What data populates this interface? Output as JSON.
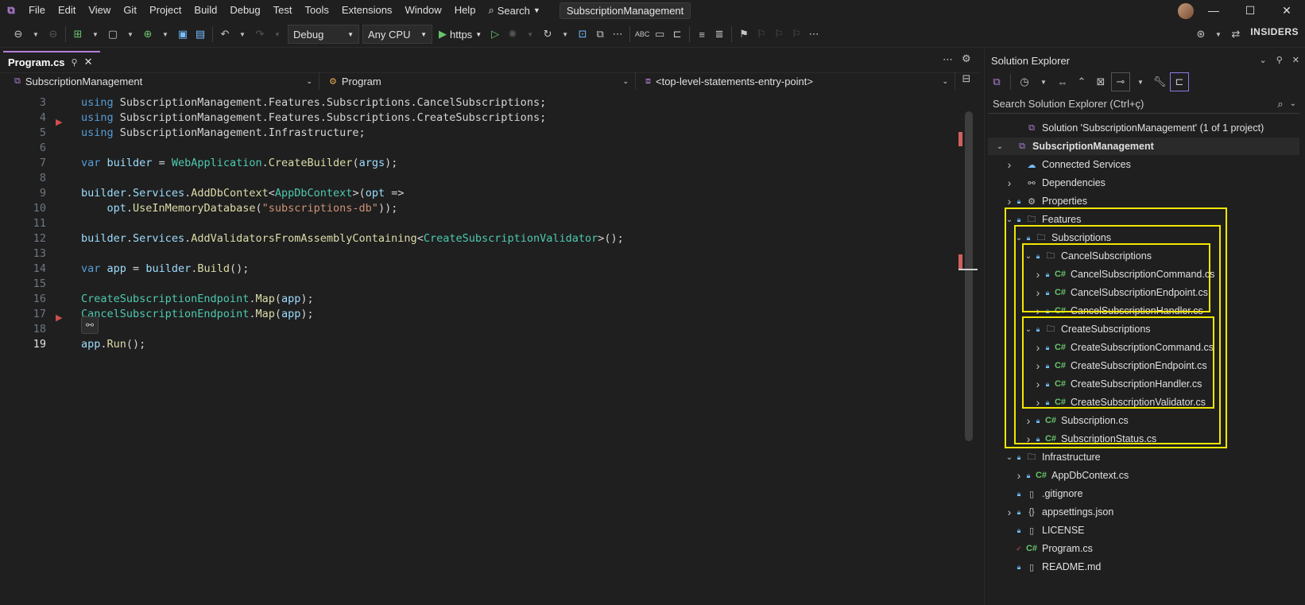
{
  "menu": [
    "File",
    "Edit",
    "View",
    "Git",
    "Project",
    "Build",
    "Debug",
    "Test",
    "Tools",
    "Extensions",
    "Window",
    "Help"
  ],
  "search_label": "Search",
  "window_title": "SubscriptionManagement",
  "toolbar": {
    "config": "Debug",
    "platform": "Any CPU",
    "run_profile": "https",
    "insiders": "INSIDERS"
  },
  "editor_tab": {
    "label": "Program.cs"
  },
  "navbar": {
    "project": "SubscriptionManagement",
    "type": "Program",
    "member": "<top-level-statements-entry-point>"
  },
  "code_lines": [
    {
      "n": "3",
      "tokens": [
        [
          "kw",
          "using"
        ],
        [
          "pl",
          " SubscriptionManagement.Features.Subscriptions.CancelSubscriptions;"
        ]
      ]
    },
    {
      "n": "4",
      "tokens": [
        [
          "kw",
          "using"
        ],
        [
          "pl",
          " SubscriptionManagement.Features.Subscriptions.CreateSubscriptions;"
        ]
      ]
    },
    {
      "n": "5",
      "tokens": [
        [
          "kw",
          "using"
        ],
        [
          "pl",
          " SubscriptionManagement.Infrastructure;"
        ]
      ]
    },
    {
      "n": "6",
      "tokens": []
    },
    {
      "n": "7",
      "tokens": [
        [
          "kw",
          "var"
        ],
        [
          "pl",
          " "
        ],
        [
          "id",
          "builder"
        ],
        [
          "pl",
          " = "
        ],
        [
          "ty",
          "WebApplication"
        ],
        [
          "pl",
          "."
        ],
        [
          "fn",
          "CreateBuilder"
        ],
        [
          "pl",
          "("
        ],
        [
          "id",
          "args"
        ],
        [
          "pl",
          ");"
        ]
      ]
    },
    {
      "n": "8",
      "tokens": []
    },
    {
      "n": "9",
      "tokens": [
        [
          "id",
          "builder"
        ],
        [
          "pl",
          "."
        ],
        [
          "id",
          "Services"
        ],
        [
          "pl",
          "."
        ],
        [
          "fn",
          "AddDbContext"
        ],
        [
          "pl",
          "<"
        ],
        [
          "ty",
          "AppDbContext"
        ],
        [
          "pl",
          ">("
        ],
        [
          "id",
          "opt"
        ],
        [
          "pl",
          " =>"
        ]
      ]
    },
    {
      "n": "10",
      "tokens": [
        [
          "pl",
          "    "
        ],
        [
          "id",
          "opt"
        ],
        [
          "pl",
          "."
        ],
        [
          "fn",
          "UseInMemoryDatabase"
        ],
        [
          "pl",
          "("
        ],
        [
          "str",
          "\"subscriptions-db\""
        ],
        [
          "pl",
          "));"
        ]
      ]
    },
    {
      "n": "11",
      "tokens": []
    },
    {
      "n": "12",
      "tokens": [
        [
          "id",
          "builder"
        ],
        [
          "pl",
          "."
        ],
        [
          "id",
          "Services"
        ],
        [
          "pl",
          "."
        ],
        [
          "fn",
          "AddValidatorsFromAssemblyContaining"
        ],
        [
          "pl",
          "<"
        ],
        [
          "ty",
          "CreateSubscriptionValidator"
        ],
        [
          "pl",
          ">();"
        ]
      ]
    },
    {
      "n": "13",
      "tokens": []
    },
    {
      "n": "14",
      "tokens": [
        [
          "kw",
          "var"
        ],
        [
          "pl",
          " "
        ],
        [
          "id",
          "app"
        ],
        [
          "pl",
          " = "
        ],
        [
          "id",
          "builder"
        ],
        [
          "pl",
          "."
        ],
        [
          "fn",
          "Build"
        ],
        [
          "pl",
          "();"
        ]
      ]
    },
    {
      "n": "15",
      "tokens": []
    },
    {
      "n": "16",
      "tokens": [
        [
          "ty",
          "CreateSubscriptionEndpoint"
        ],
        [
          "pl",
          "."
        ],
        [
          "fn",
          "Map"
        ],
        [
          "pl",
          "("
        ],
        [
          "id",
          "app"
        ],
        [
          "pl",
          ");"
        ]
      ]
    },
    {
      "n": "17",
      "tokens": [
        [
          "ty",
          "CancelSubscriptionEndpoint"
        ],
        [
          "pl",
          "."
        ],
        [
          "fn",
          "Map"
        ],
        [
          "pl",
          "("
        ],
        [
          "id",
          "app"
        ],
        [
          "pl",
          ");"
        ]
      ]
    },
    {
      "n": "18",
      "tokens": []
    },
    {
      "n": "19",
      "tokens": [
        [
          "id",
          "app"
        ],
        [
          "pl",
          "."
        ],
        [
          "fn",
          "Run"
        ],
        [
          "pl",
          "();"
        ]
      ]
    }
  ],
  "solution_explorer": {
    "title": "Solution Explorer",
    "search_placeholder": "Search Solution Explorer (Ctrl+ç)",
    "items": [
      {
        "label": "Solution 'SubscriptionManagement' (1 of 1 project)",
        "depth": 1,
        "chev": "",
        "lock": false,
        "icon": "solution"
      },
      {
        "label": "SubscriptionManagement",
        "depth": 0,
        "chev": "v",
        "lock": false,
        "icon": "project",
        "bold": true
      },
      {
        "label": "Connected Services",
        "depth": 1,
        "chev": ">",
        "lock": false,
        "icon": "cloud"
      },
      {
        "label": "Dependencies",
        "depth": 1,
        "chev": ">",
        "lock": false,
        "icon": "deps"
      },
      {
        "label": "Properties",
        "depth": 1,
        "chev": ">",
        "lock": true,
        "icon": "props"
      },
      {
        "label": "Features",
        "depth": 1,
        "chev": "v",
        "lock": true,
        "icon": "folder"
      },
      {
        "label": "Subscriptions",
        "depth": 2,
        "chev": "v",
        "lock": true,
        "icon": "folder"
      },
      {
        "label": "CancelSubscriptions",
        "depth": 3,
        "chev": "v",
        "lock": true,
        "icon": "folder"
      },
      {
        "label": "CancelSubscriptionCommand.cs",
        "depth": 4,
        "chev": ">",
        "lock": true,
        "icon": "cs"
      },
      {
        "label": "CancelSubscriptionEndpoint.cs",
        "depth": 4,
        "chev": ">",
        "lock": true,
        "icon": "cs"
      },
      {
        "label": "CancelSubscriptionHandler.cs",
        "depth": 4,
        "chev": ">",
        "lock": true,
        "icon": "cs"
      },
      {
        "label": "CreateSubscriptions",
        "depth": 3,
        "chev": "v",
        "lock": true,
        "icon": "folder"
      },
      {
        "label": "CreateSubscriptionCommand.cs",
        "depth": 4,
        "chev": ">",
        "lock": true,
        "icon": "cs"
      },
      {
        "label": "CreateSubscriptionEndpoint.cs",
        "depth": 4,
        "chev": ">",
        "lock": true,
        "icon": "cs"
      },
      {
        "label": "CreateSubscriptionHandler.cs",
        "depth": 4,
        "chev": ">",
        "lock": true,
        "icon": "cs"
      },
      {
        "label": "CreateSubscriptionValidator.cs",
        "depth": 4,
        "chev": ">",
        "lock": true,
        "icon": "cs"
      },
      {
        "label": "Subscription.cs",
        "depth": 3,
        "chev": ">",
        "lock": true,
        "icon": "cs"
      },
      {
        "label": "SubscriptionStatus.cs",
        "depth": 3,
        "chev": ">",
        "lock": true,
        "icon": "cs"
      },
      {
        "label": "Infrastructure",
        "depth": 1,
        "chev": "v",
        "lock": true,
        "icon": "folder"
      },
      {
        "label": "AppDbContext.cs",
        "depth": 2,
        "chev": ">",
        "lock": true,
        "icon": "cs"
      },
      {
        "label": ".gitignore",
        "depth": 1,
        "chev": "",
        "lock": true,
        "icon": "file"
      },
      {
        "label": "appsettings.json",
        "depth": 1,
        "chev": ">",
        "lock": true,
        "icon": "json"
      },
      {
        "label": "LICENSE",
        "depth": 1,
        "chev": "",
        "lock": true,
        "icon": "file"
      },
      {
        "label": "Program.cs",
        "depth": 1,
        "chev": "",
        "lock": false,
        "check": true,
        "icon": "cs"
      },
      {
        "label": "README.md",
        "depth": 1,
        "chev": "",
        "lock": true,
        "icon": "file"
      }
    ]
  },
  "colors": {
    "accent": "#b180d7",
    "highlight": "#f2e600",
    "keyword": "#569cd6",
    "type": "#4ec9b0",
    "method": "#dcdcaa",
    "string": "#ce9178"
  }
}
